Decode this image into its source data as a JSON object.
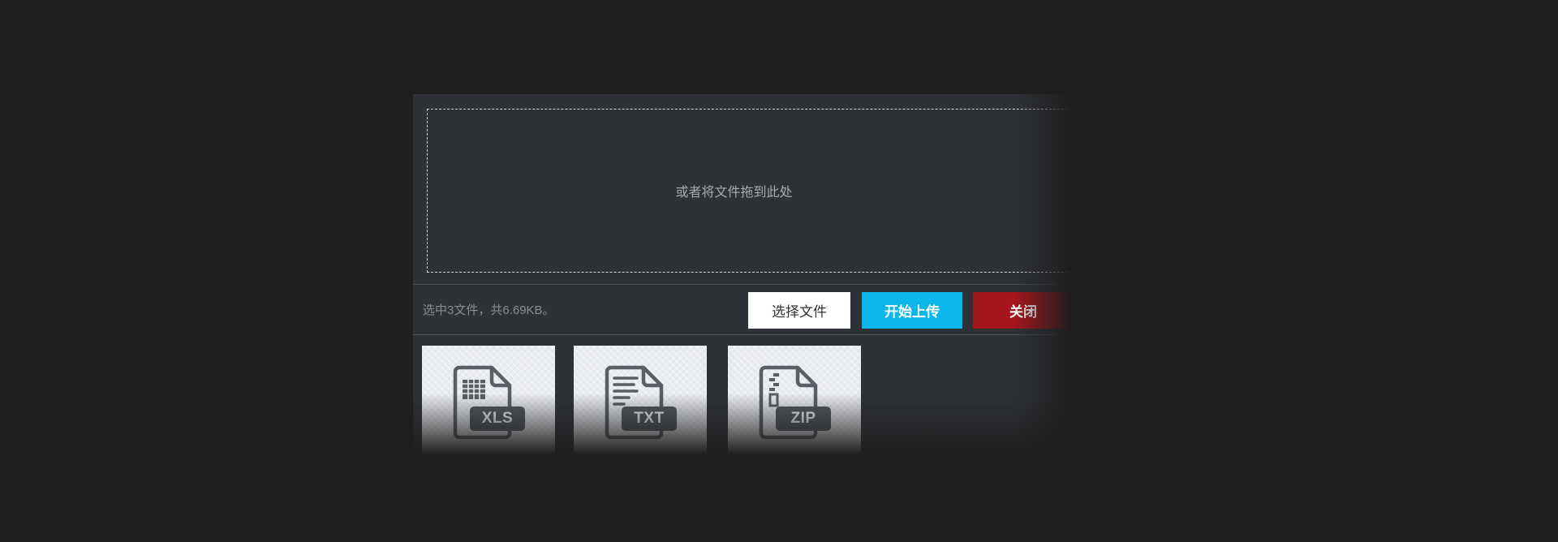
{
  "dropzone": {
    "hint": "或者将文件拖到此处"
  },
  "status": {
    "text": "选中3文件，共6.69KB。"
  },
  "buttons": {
    "select": "选择文件",
    "upload": "开始上传",
    "close": "关闭"
  },
  "colors": {
    "upload_button": "#0bb7ea",
    "close_button": "#a4161c"
  },
  "files": [
    {
      "ext": "XLS",
      "icon": "spreadsheet-file-icon"
    },
    {
      "ext": "TXT",
      "icon": "text-file-icon"
    },
    {
      "ext": "ZIP",
      "icon": "zip-file-icon"
    }
  ]
}
